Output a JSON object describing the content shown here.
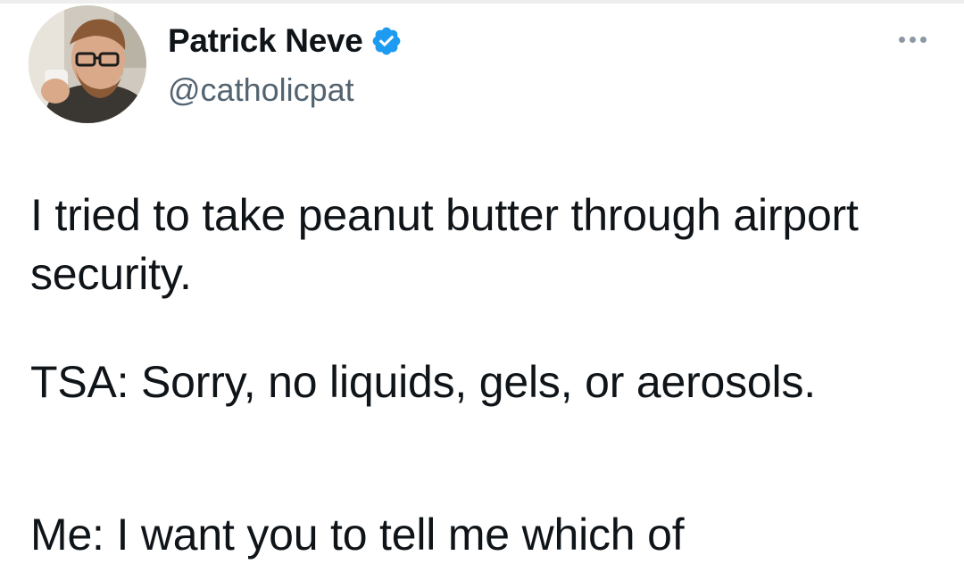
{
  "tweet": {
    "author": {
      "display_name": "Patrick Neve",
      "handle": "@catholicpat",
      "verified_icon": "verified-badge-icon",
      "avatar_icon": "profile-avatar"
    },
    "more_icon": "more-options-icon",
    "paragraphs": [
      "I tried to take peanut butter through airport security.",
      "TSA: Sorry, no liquids, gels, or aerosols.",
      "Me: I want you to tell me which of"
    ]
  },
  "colors": {
    "text": "#0f1419",
    "secondary_text": "#536471",
    "verified_blue": "#1d9bf0",
    "more_dots": "#8b98a5"
  }
}
